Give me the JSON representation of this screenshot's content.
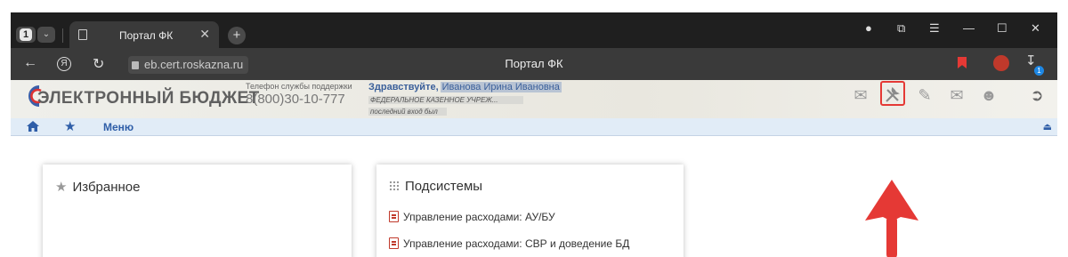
{
  "browser": {
    "tab_count": "1",
    "tab_title": "Портал ФК",
    "url": "eb.cert.roskazna.ru",
    "page_title": "Портал ФК",
    "downloads_badge": "1"
  },
  "header": {
    "logo_text": "ЭЛЕКТРОННЫЙ БЮДЖЕТ",
    "support_label": "Телефон службы поддержки",
    "support_phone": "8(800)30-10-777",
    "greeting": "Здравствуйте,",
    "user_name": "Иванова Ирина Ивановна",
    "organization": "ФЕДЕРАЛЬНОЕ КАЗЕННОЕ УЧРЕЖ...",
    "last_login": "последний вход был",
    "icons": [
      "messages-settings-icon",
      "tools-icon",
      "edit-icon",
      "alert-mail-icon",
      "user-icon",
      "logout-icon"
    ],
    "highlight_color": "#e53935"
  },
  "nav": {
    "menu_label": "Меню"
  },
  "favorites": {
    "title": "Избранное"
  },
  "subsystems": {
    "title": "Подсистемы",
    "items": [
      {
        "label": "Управление расходами: АУ/БУ"
      },
      {
        "label": "Управление расходами: СВР и доведение БД"
      }
    ]
  },
  "colors": {
    "accent_blue": "#2f5ea8",
    "annotation_red": "#e53935"
  }
}
